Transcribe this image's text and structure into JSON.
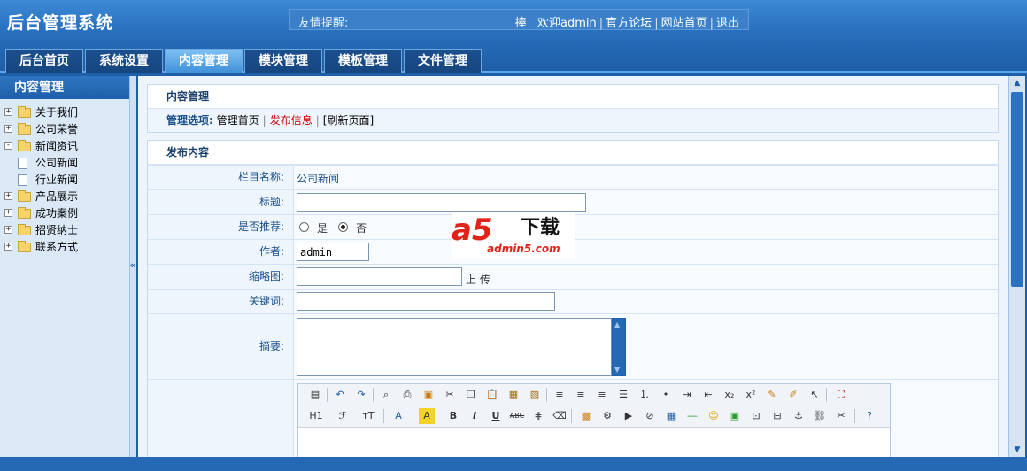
{
  "header": {
    "app_title": "后台管理系统",
    "notice_label": "友情提醒:",
    "welcome_prefix": "捧",
    "welcome": "欢迎admin",
    "links": [
      "官方论坛",
      "网站首页",
      "退出"
    ]
  },
  "nav": {
    "tabs": [
      {
        "label": "后台首页",
        "active": false
      },
      {
        "label": "系统设置",
        "active": false
      },
      {
        "label": "内容管理",
        "active": true
      },
      {
        "label": "模块管理",
        "active": false
      },
      {
        "label": "模板管理",
        "active": false
      },
      {
        "label": "文件管理",
        "active": false
      }
    ]
  },
  "sidebar": {
    "title": "内容管理",
    "items": [
      {
        "label": "关于我们",
        "type": "folder",
        "expander": "+"
      },
      {
        "label": "公司荣誉",
        "type": "folder",
        "expander": "+"
      },
      {
        "label": "新闻资讯",
        "type": "folder",
        "expander": "-"
      },
      {
        "label": "公司新闻",
        "type": "doc"
      },
      {
        "label": "行业新闻",
        "type": "doc"
      },
      {
        "label": "产品展示",
        "type": "folder",
        "expander": "+"
      },
      {
        "label": "成功案例",
        "type": "folder",
        "expander": "+"
      },
      {
        "label": "招贤纳士",
        "type": "folder",
        "expander": "+"
      },
      {
        "label": "联系方式",
        "type": "folder",
        "expander": "+"
      }
    ],
    "collapse_glyph": "«"
  },
  "main": {
    "section_title": "内容管理",
    "options_label": "管理选项:",
    "options": {
      "home": "管理首页",
      "publish": "发布信息",
      "refresh": "[刷新页面]"
    },
    "publish_title": "发布内容",
    "form": {
      "category_label": "栏目名称:",
      "category_value": "公司新闻",
      "title_label": "标题:",
      "title_value": "",
      "recommend_label": "是否推荐:",
      "recommend_yes": "是",
      "recommend_no": "否",
      "author_label": "作者:",
      "author_value": "admin",
      "thumb_label": "缩略图:",
      "thumb_value": "",
      "upload_label": "上 传",
      "keywords_label": "关键词:",
      "keywords_value": "",
      "summary_label": "摘要:",
      "summary_value": ""
    },
    "editor": {
      "heading_btn": "H1",
      "font_btn": "ℱ",
      "size_btn": "тT",
      "font_color_btn": "A",
      "bg_color_btn": "A",
      "bold_btn": "B",
      "italic_btn": "I",
      "underline_btn": "U",
      "strike_btn": "ABC",
      "sub_btn": "x₂",
      "sup_btn": "x²"
    }
  },
  "watermark": {
    "brand": "a5",
    "cn": "下载",
    "url": "admin5.com"
  }
}
